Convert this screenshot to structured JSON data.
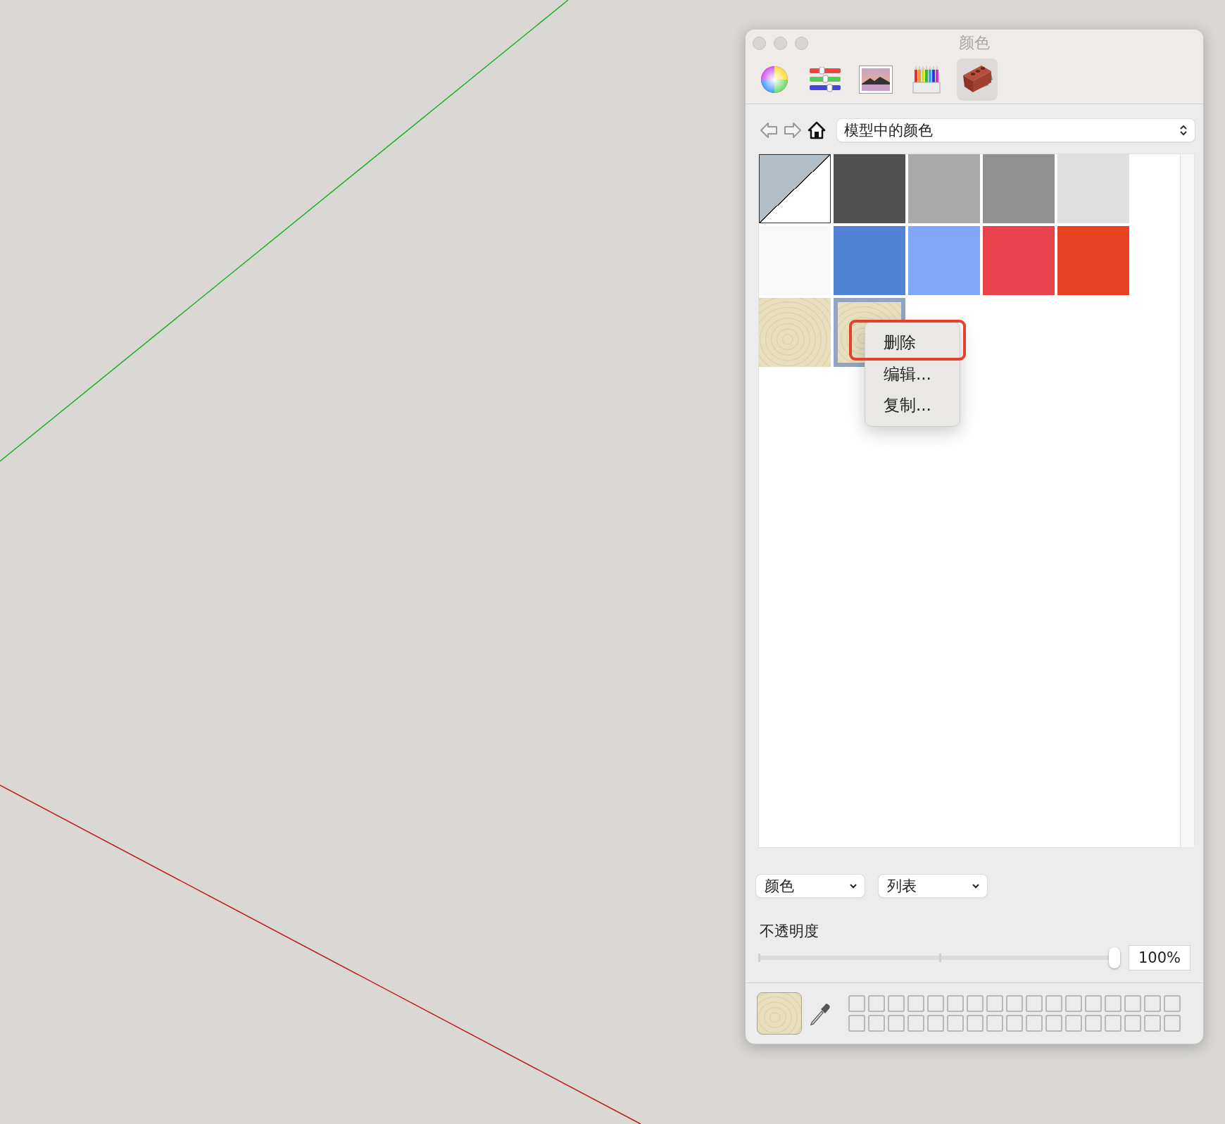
{
  "window": {
    "title": "颜色"
  },
  "toolbar_tabs": [
    {
      "kind": "wheel",
      "selected": false
    },
    {
      "kind": "sliders",
      "selected": false
    },
    {
      "kind": "image",
      "selected": false
    },
    {
      "kind": "pencils",
      "selected": false
    },
    {
      "kind": "brick",
      "selected": true
    }
  ],
  "nav": {
    "dropdown": "模型中的颜色"
  },
  "swatches": [
    {
      "kind": "split",
      "color": "#b4bec6",
      "selected": false
    },
    {
      "kind": "solid",
      "color": "#505050",
      "selected": false
    },
    {
      "kind": "solid",
      "color": "#aaaaaa",
      "selected": false
    },
    {
      "kind": "solid",
      "color": "#919191",
      "selected": false
    },
    {
      "kind": "solid",
      "color": "#dfdfdf",
      "selected": false
    },
    {
      "kind": "solid",
      "color": "#f8f8f8",
      "selected": false
    },
    {
      "kind": "solid",
      "color": "#5282d3",
      "selected": false
    },
    {
      "kind": "solid",
      "color": "#81a8f8",
      "selected": false
    },
    {
      "kind": "solid",
      "color": "#e8434c",
      "selected": false
    },
    {
      "kind": "solid",
      "color": "#e94222",
      "selected": false
    },
    {
      "kind": "texture",
      "color": "#e8dfbf",
      "selected": false
    },
    {
      "kind": "texture",
      "color": "#e8dfbf",
      "selected": true
    }
  ],
  "context_menu": {
    "items": [
      {
        "label": "删除",
        "annotated": true
      },
      {
        "label": "编辑...",
        "annotated": false
      },
      {
        "label": "复制...",
        "annotated": false
      }
    ]
  },
  "dropdowns": [
    "颜色",
    "列表"
  ],
  "opacity": {
    "label": "不透明度",
    "level": 1,
    "value": "100%"
  },
  "current": {
    "color": "#e8dfbf"
  }
}
